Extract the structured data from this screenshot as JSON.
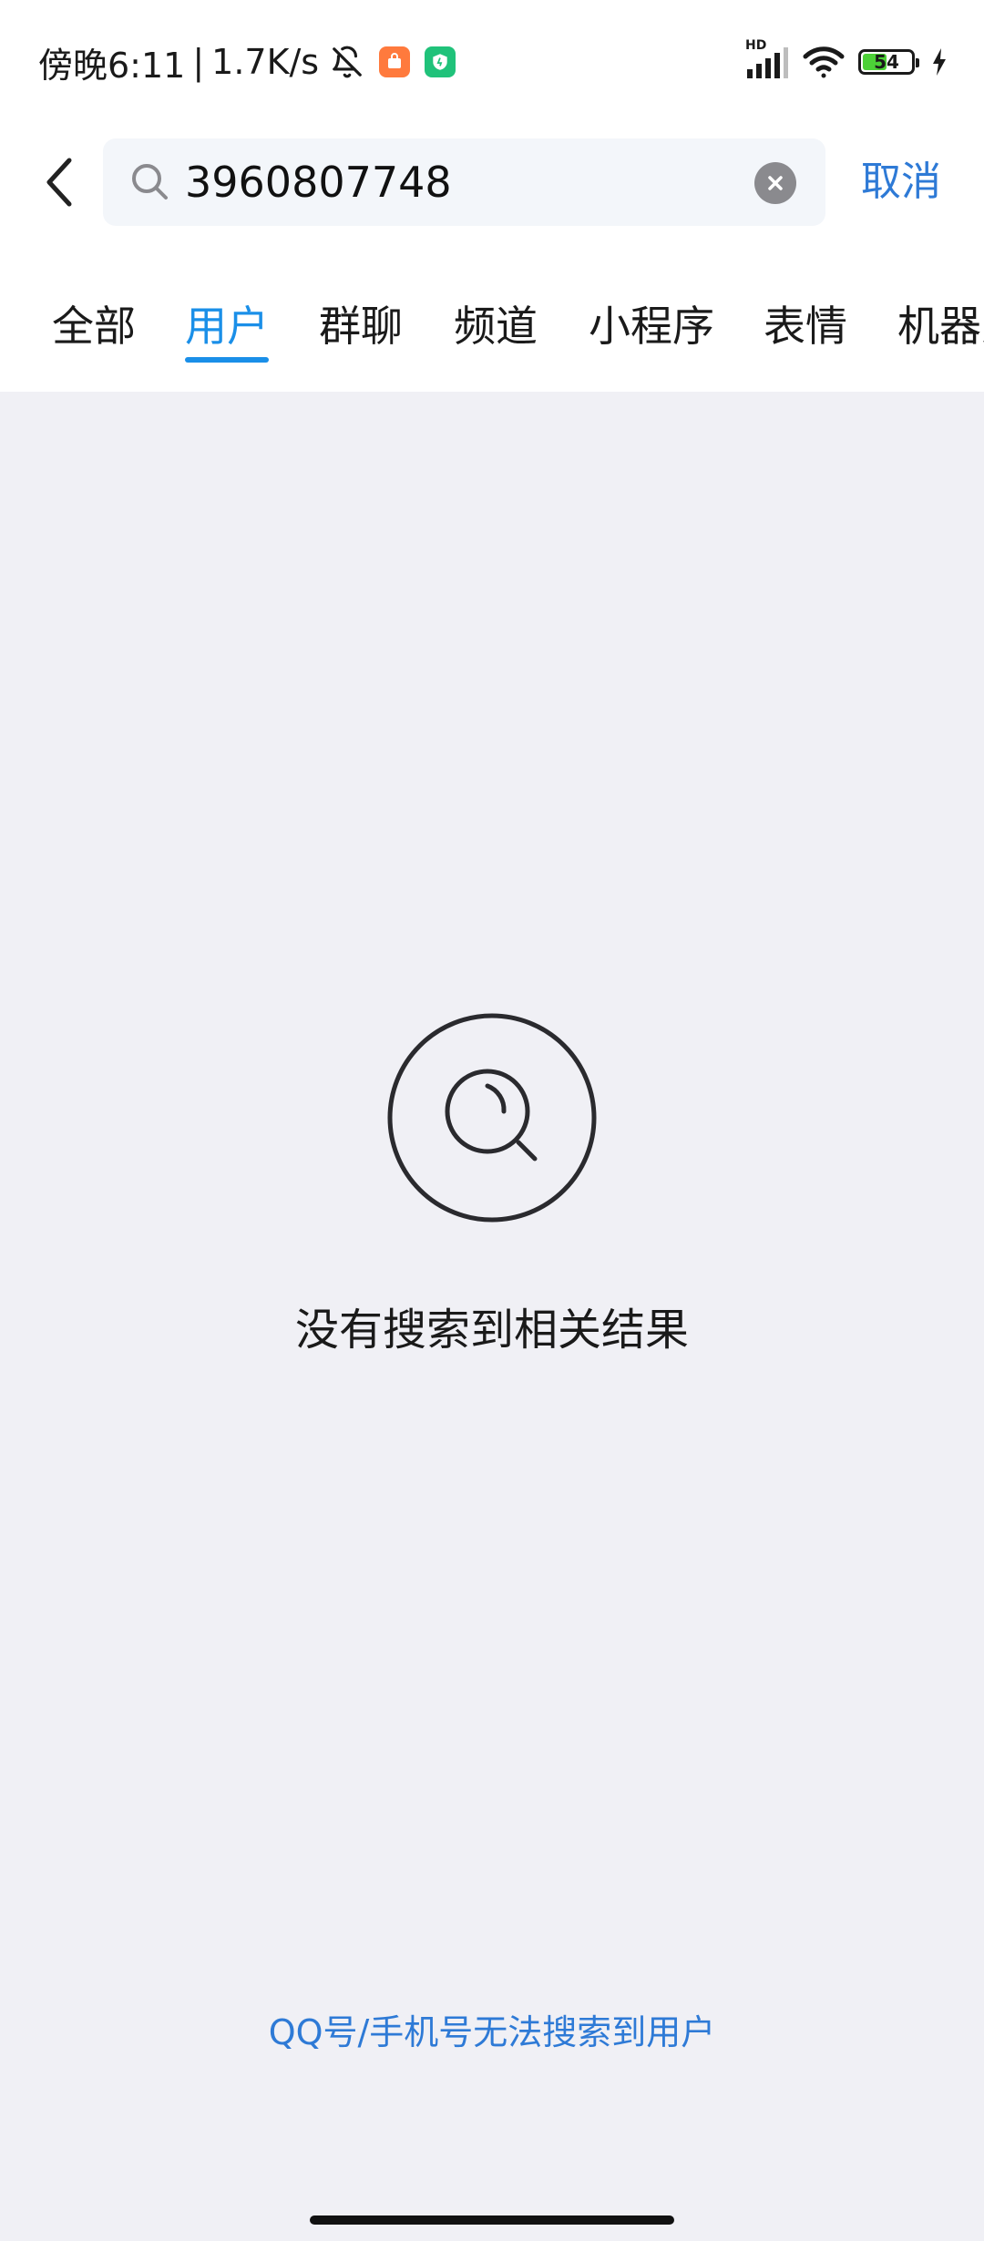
{
  "status_bar": {
    "time": "傍晚6:11",
    "separator": "|",
    "net_speed": "1.7K/s",
    "network_label": "HD",
    "battery_level": 54,
    "battery_text": "54",
    "icons": [
      "bell-off-icon",
      "shopping-app-icon",
      "security-app-icon",
      "signal-icon",
      "wifi-icon",
      "battery-icon",
      "charging-icon"
    ]
  },
  "search": {
    "query": "3960807748",
    "cancel_label": "取消"
  },
  "tabs": [
    {
      "label": "全部"
    },
    {
      "label": "用户"
    },
    {
      "label": "群聊"
    },
    {
      "label": "频道"
    },
    {
      "label": "小程序"
    },
    {
      "label": "表情"
    },
    {
      "label": "机器人"
    }
  ],
  "active_tab": "用户",
  "empty_state": {
    "message": "没有搜索到相关结果"
  },
  "hint": {
    "label": "QQ号/手机号无法搜索到用户"
  },
  "colors": {
    "accent": "#1a8fe8",
    "link": "#2e7ad6",
    "background": "#f0f0f5"
  }
}
